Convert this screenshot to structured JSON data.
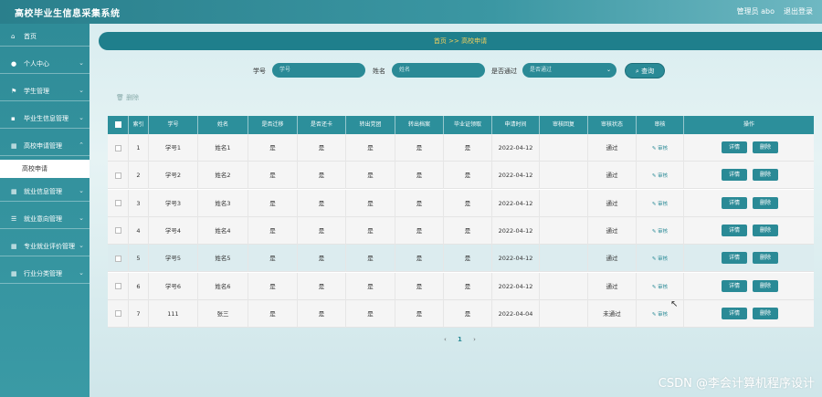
{
  "header": {
    "title": "高校毕业生信息采集系统",
    "user": "管理员 abo",
    "logout": "退出登录"
  },
  "sidebar": {
    "items": [
      {
        "label": "首页",
        "icon": "home-icon",
        "glyph": "⌂"
      },
      {
        "label": "个人中心",
        "icon": "user-icon",
        "glyph": "●"
      },
      {
        "label": "学生管理",
        "icon": "flag-icon",
        "glyph": "⚑"
      },
      {
        "label": "毕业生信息管理",
        "icon": "chart-icon",
        "glyph": "▪"
      },
      {
        "label": "高校申请管理",
        "icon": "grid-icon",
        "glyph": "▦"
      },
      {
        "label": "就业信息管理",
        "icon": "grid-icon",
        "glyph": "▦"
      },
      {
        "label": "就业意向管理",
        "icon": "list-icon",
        "glyph": "☰"
      },
      {
        "label": "专业就业评价管理",
        "icon": "grid-icon",
        "glyph": "▦"
      },
      {
        "label": "行业分类管理",
        "icon": "grid-icon",
        "glyph": "▦"
      }
    ],
    "active_sub": "高校申请"
  },
  "breadcrumb": "首页 >> 高校申请",
  "search": {
    "student_no_label": "学号",
    "student_no_placeholder": "学号",
    "name_label": "姓名",
    "name_placeholder": "姓名",
    "pass_label": "是否通过",
    "pass_placeholder": "是否通过",
    "query_button": "查询"
  },
  "toolbar": {
    "delete_label": "删除"
  },
  "table": {
    "columns": [
      "索引",
      "学号",
      "姓名",
      "是否迁移",
      "是否还卡",
      "转出党团",
      "转出档案",
      "毕业证领取",
      "申请时间",
      "审核回复",
      "审核状态",
      "审核",
      "操作"
    ],
    "audit_label": "审核",
    "detail_label": "详情",
    "delete_label": "删除",
    "rows": [
      {
        "idx": "1",
        "no": "学号1",
        "name": "姓名1",
        "c1": "是",
        "c2": "是",
        "c3": "是",
        "c4": "是",
        "c5": "是",
        "date": "2022-04-12",
        "reply": "",
        "status": "通过"
      },
      {
        "idx": "2",
        "no": "学号2",
        "name": "姓名2",
        "c1": "是",
        "c2": "是",
        "c3": "是",
        "c4": "是",
        "c5": "是",
        "date": "2022-04-12",
        "reply": "",
        "status": "通过"
      },
      {
        "idx": "3",
        "no": "学号3",
        "name": "姓名3",
        "c1": "是",
        "c2": "是",
        "c3": "是",
        "c4": "是",
        "c5": "是",
        "date": "2022-04-12",
        "reply": "",
        "status": "通过"
      },
      {
        "idx": "4",
        "no": "学号4",
        "name": "姓名4",
        "c1": "是",
        "c2": "是",
        "c3": "是",
        "c4": "是",
        "c5": "是",
        "date": "2022-04-12",
        "reply": "",
        "status": "通过"
      },
      {
        "idx": "5",
        "no": "学号5",
        "name": "姓名5",
        "c1": "是",
        "c2": "是",
        "c3": "是",
        "c4": "是",
        "c5": "是",
        "date": "2022-04-12",
        "reply": "",
        "status": "通过"
      },
      {
        "idx": "6",
        "no": "学号6",
        "name": "姓名6",
        "c1": "是",
        "c2": "是",
        "c3": "是",
        "c4": "是",
        "c5": "是",
        "date": "2022-04-12",
        "reply": "",
        "status": "通过"
      },
      {
        "idx": "7",
        "no": "111",
        "name": "张三",
        "c1": "是",
        "c2": "是",
        "c3": "是",
        "c4": "是",
        "c5": "是",
        "date": "2022-04-04",
        "reply": "",
        "status": "未通过"
      }
    ]
  },
  "pagination": {
    "prev": "‹",
    "current": "1",
    "next": "›"
  },
  "watermark": "CSDN @李会计算机程序设计",
  "colors": {
    "accent": "#2a8a96",
    "crumb_text": "#f5d15c"
  }
}
